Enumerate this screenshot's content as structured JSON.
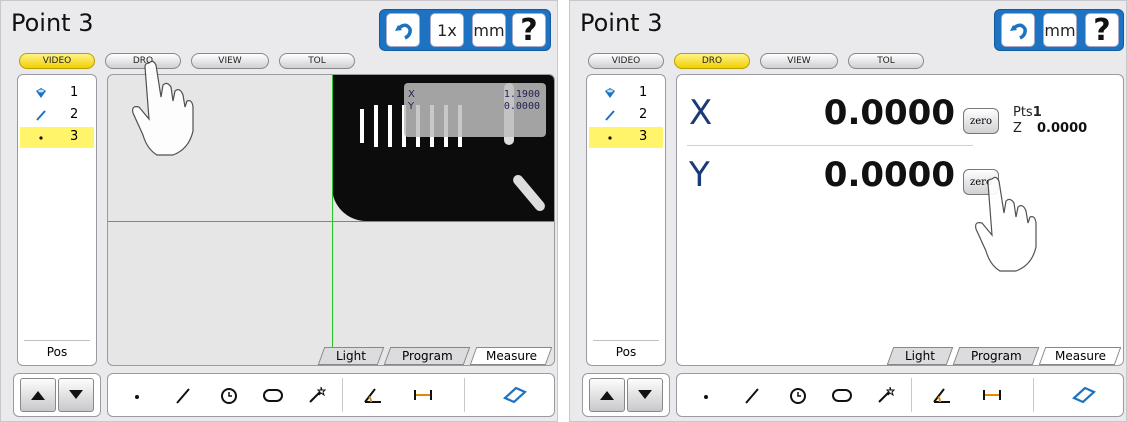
{
  "left_screen": {
    "title": "Point 3",
    "toolbar": {
      "undo_icon": "undo-icon",
      "magnification": "1x",
      "units": "mm",
      "help": "?"
    },
    "tabs": [
      {
        "label": "VIDEO",
        "active": true
      },
      {
        "label": "DRO",
        "active": false
      },
      {
        "label": "VIEW",
        "active": false
      },
      {
        "label": "TOL",
        "active": false
      }
    ],
    "features": [
      {
        "num": "1",
        "icon": "circle-feature-icon",
        "selected": false
      },
      {
        "num": "2",
        "icon": "line-feature-icon",
        "selected": false
      },
      {
        "num": "3",
        "icon": "point-feature-icon",
        "selected": true
      }
    ],
    "pos_label": "Pos",
    "readout": {
      "x_label": "X",
      "x_value": "1.1900",
      "y_label": "Y",
      "y_value": "0.0000"
    },
    "view_tabs": [
      "Light",
      "Program",
      "Measure"
    ],
    "active_view_tab": "Measure"
  },
  "right_screen": {
    "title": "Point 3",
    "toolbar": {
      "undo_icon": "undo-icon",
      "units": "mm",
      "help": "?"
    },
    "tabs": [
      {
        "label": "VIDEO",
        "active": false
      },
      {
        "label": "DRO",
        "active": true
      },
      {
        "label": "VIEW",
        "active": false
      },
      {
        "label": "TOL",
        "active": false
      }
    ],
    "features": [
      {
        "num": "1",
        "icon": "circle-feature-icon",
        "selected": false
      },
      {
        "num": "2",
        "icon": "line-feature-icon",
        "selected": false
      },
      {
        "num": "3",
        "icon": "point-feature-icon",
        "selected": true
      }
    ],
    "pos_label": "Pos",
    "dro": {
      "x_label": "X",
      "x_value": "0.0000",
      "x_zero": "zero",
      "y_label": "Y",
      "y_value": "0.0000",
      "y_zero": "zero",
      "pts_label": "Pts",
      "pts_value": "1",
      "z_label": "Z",
      "z_value": "0.0000"
    },
    "view_tabs": [
      "Light",
      "Program",
      "Measure"
    ],
    "active_view_tab": "Measure"
  },
  "bottom_tools": [
    "point-tool-icon",
    "line-tool-icon",
    "circle-tool-icon",
    "slot-tool-icon",
    "auto-measure-icon",
    "angle-tool-icon",
    "distance-tool-icon",
    "rectangle-tool-icon"
  ],
  "colors": {
    "accent_blue": "#1d73c2",
    "active_tab_yellow": "#f0d000",
    "selected_row": "#fff46a",
    "crosshair_green": "#29c429"
  }
}
